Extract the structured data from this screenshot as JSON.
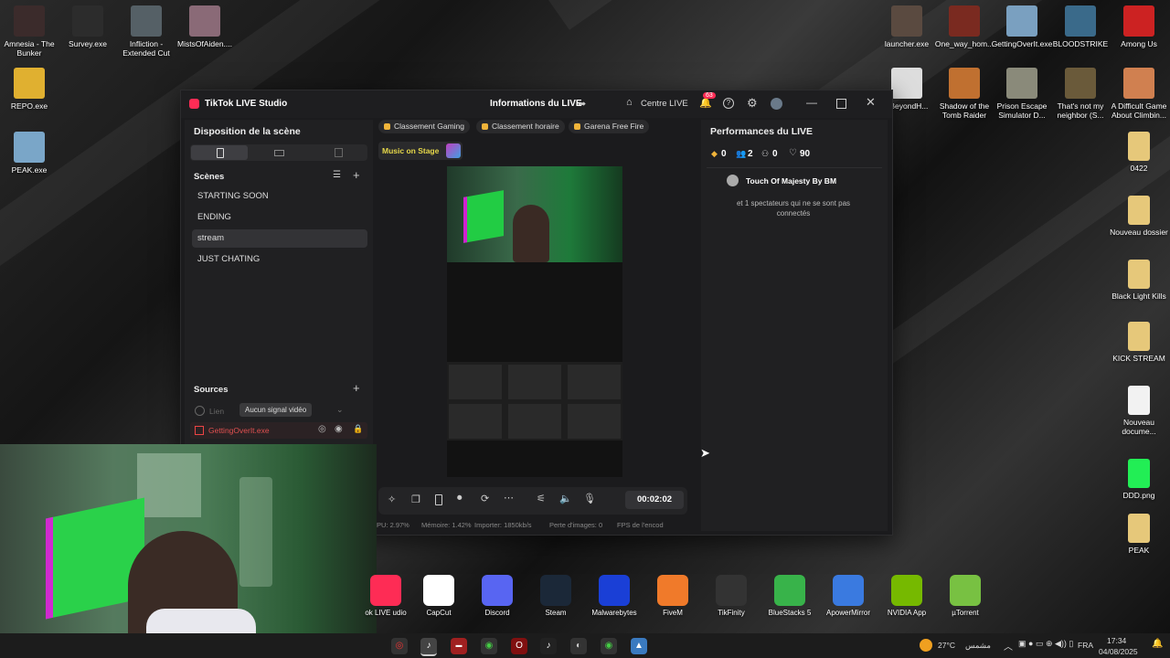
{
  "desktop_left": [
    {
      "label": "Amnesia - The Bunker",
      "color": "#3b2b2b"
    },
    {
      "label": "Survey.exe",
      "color": "#2c2c2c"
    },
    {
      "label": "Infliction - Extended Cut",
      "color": "#556066"
    },
    {
      "label": "MistsOfAiden....",
      "color": "#8a6a77"
    },
    {
      "label": "REPO.exe",
      "color": "#e0b030"
    },
    {
      "label": "PEAK.exe",
      "color": "#7aa6c8"
    }
  ],
  "desktop_right": [
    {
      "label": "launcher.exe",
      "color": "#5a4a40"
    },
    {
      "label": "One_way_hom...",
      "color": "#7a2a20"
    },
    {
      "label": "GettingOverIt.exe",
      "color": "#7aa0c0"
    },
    {
      "label": "BLOODSTRIKE",
      "color": "#3a6a8a"
    },
    {
      "label": "Among Us",
      "color": "#cc2222"
    },
    {
      "label": "eBeyondH...",
      "color": "#dddddd"
    },
    {
      "label": "Shadow of the Tomb Raider",
      "color": "#c07030"
    },
    {
      "label": "Prison Escape Simulator D...",
      "color": "#8a8a7a"
    },
    {
      "label": "That's not my neighbor (S...",
      "color": "#6a5a3a"
    },
    {
      "label": "A Difficult Game About Climbin...",
      "color": "#d08050"
    },
    {
      "label": "0422",
      "color": "#e6c87a"
    },
    {
      "label": "Nouveau dossier",
      "color": "#e6c87a"
    },
    {
      "label": "Black Light Kills",
      "color": "#e6c87a"
    },
    {
      "label": "KICK STREAM",
      "color": "#e6c87a"
    },
    {
      "label": "Nouveau docume...",
      "color": "#f2f2f2"
    },
    {
      "label": "DDD.png",
      "color": "#22ee55"
    },
    {
      "label": "PEAK",
      "color": "#e6c87a"
    }
  ],
  "window": {
    "title": "TikTok LIVE Studio",
    "center_title": "Informations du LIVE",
    "centre_live": "Centre LIVE",
    "notif_count": "63"
  },
  "left_panel": {
    "title": "Disposition de la scène",
    "scenes_label": "Scènes",
    "scenes": [
      "STARTING SOON",
      "ENDING",
      "stream",
      "JUST CHATING"
    ],
    "active_scene": "stream",
    "sources_label": "Sources",
    "source_link": "Lien",
    "no_signal": "Aucun signal vidéo",
    "source_game": "GettingOverIt.exe"
  },
  "center": {
    "chips": [
      "Classement Gaming",
      "Classement horaire",
      "Garena Free Fire"
    ],
    "music": "Music on Stage",
    "timer": "00:02:02",
    "stats": {
      "cpu": "PU: 2.97%",
      "memory": "Mémoire: 1.42%",
      "import": "Importer: 1850kb/s",
      "frames": "Perte d'images: 0",
      "fps": "FPS de l'encod"
    }
  },
  "right_panel": {
    "title": "Performances du LIVE",
    "gifts": "0",
    "viewers": "2",
    "follows": "0",
    "likes": "90",
    "user": "Touch Of Majesty By BM",
    "note": "et 1 spectateurs qui ne se sont pas connectés"
  },
  "taskbar_apps": [
    {
      "label": "TikTok LIVE Studio",
      "short": "ok LIVE udio",
      "color": "#fe2c55"
    },
    {
      "label": "CapCut",
      "color": "#ffffff"
    },
    {
      "label": "Discord",
      "color": "#5865f2"
    },
    {
      "label": "Steam",
      "color": "#1b2838"
    },
    {
      "label": "Malwarebytes",
      "color": "#1a3fd6"
    },
    {
      "label": "FiveM",
      "color": "#f07a2a"
    },
    {
      "label": "TikFinity",
      "color": "#333333"
    },
    {
      "label": "BlueStacks 5",
      "color": "#38b34a"
    },
    {
      "label": "ApowerMirror",
      "color": "#3a7ae0"
    },
    {
      "label": "NVIDIA App",
      "color": "#76b900"
    },
    {
      "label": "µTorrent",
      "color": "#78c142"
    }
  ],
  "tray": {
    "weather": "27°C",
    "weather_text": "مشمس",
    "lang": "FRA",
    "time": "17:34",
    "date": "04/08/2025"
  }
}
